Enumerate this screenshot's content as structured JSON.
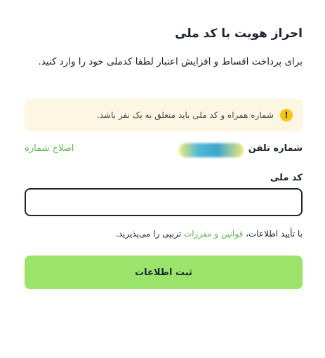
{
  "header": {
    "title": "احراز هویت با کد ملی",
    "description": "برای پرداخت اقساط و افزایش اعتبار لطفا کدملی خود را وارد کنید."
  },
  "alert": {
    "icon": "warning-icon",
    "icon_glyph": "!",
    "text": "شماره همراه و کد ملی باید متعلق به یک نفر باشد.",
    "background": "#fdf6e3",
    "icon_color": "#f5c518"
  },
  "phone": {
    "label": "شماره تلفن",
    "fix_link": "اصلاح شماره"
  },
  "national_id": {
    "label": "کد ملی",
    "value": ""
  },
  "terms": {
    "prefix": "با تأیید اطلاعات، ",
    "link": "قوانین و مقررات",
    "suffix": " تربپی را می‌پذیرید."
  },
  "submit": {
    "label": "ثبت اطلاعات"
  },
  "colors": {
    "accent_green": "#9be46b",
    "link_green": "#5ab84a",
    "text": "#1c2430"
  }
}
